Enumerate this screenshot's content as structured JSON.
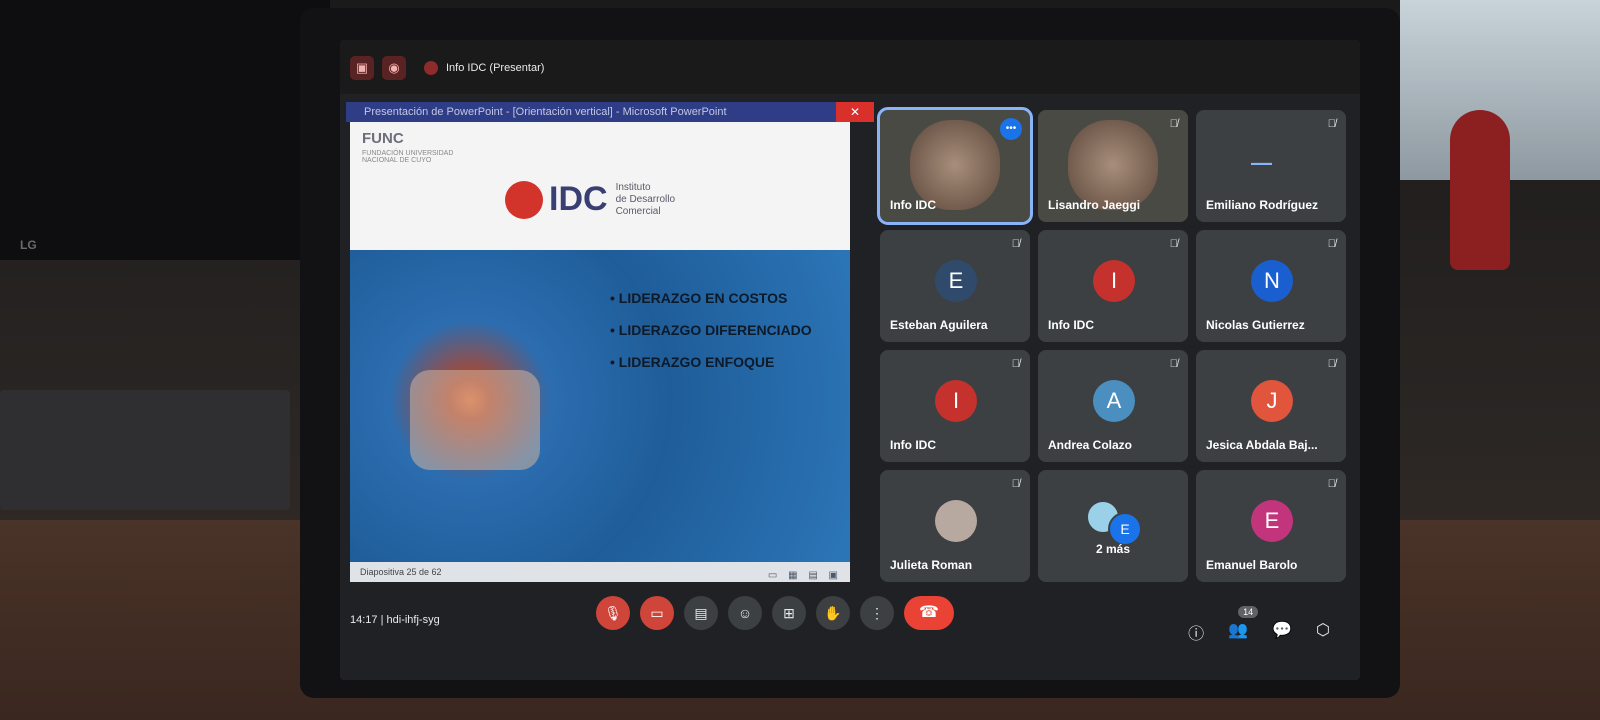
{
  "meet": {
    "presenting_label": "Info IDC (Presentar)",
    "time": "14:17",
    "meeting_code": "hdi-ihfj-syg",
    "participant_count": "14"
  },
  "powerpoint": {
    "window_title": "Presentación de PowerPoint - [Orientación vertical] - Microsoft PowerPoint",
    "status": "Diapositiva 25 de 62",
    "close_glyph": "✕",
    "view_icons": "▭ ▦ ▤ ▣"
  },
  "slide": {
    "func_logo": "FUNC",
    "func_sub": "FUNDACIÓN UNIVERSIDAD NACIONAL DE CUYO",
    "idc": "IDC",
    "idc_sub_1": "Instituto",
    "idc_sub_2": "de Desarrollo",
    "idc_sub_3": "Comercial",
    "bullets": [
      "LIDERAZGO EN COSTOS",
      "LIDERAZGO DIFERENCIADO",
      "LIDERAZGO ENFOQUE"
    ]
  },
  "participants": [
    {
      "name": "Info IDC",
      "type": "camera",
      "active": true
    },
    {
      "name": "Lisandro Jaeggi",
      "type": "camera"
    },
    {
      "name": "Emiliano Rodríguez",
      "type": "logo"
    },
    {
      "name": "Esteban Aguilera",
      "initial": "E",
      "color": "#2f4a6b"
    },
    {
      "name": "Info IDC",
      "initial": "I",
      "color": "#c5312c"
    },
    {
      "name": "Nicolas Gutierrez",
      "initial": "N",
      "color": "#1a5fd0"
    },
    {
      "name": "Info IDC",
      "initial": "I",
      "color": "#c5312c"
    },
    {
      "name": "Andrea Colazo",
      "initial": "A",
      "color": "#4a8fc0"
    },
    {
      "name": "Jesica Abdala Baj...",
      "initial": "J",
      "color": "#e0553c"
    },
    {
      "name": "Julieta Roman",
      "type": "photo"
    },
    {
      "name": "2 más",
      "type": "more"
    },
    {
      "name": "Emanuel Barolo",
      "initial": "E",
      "color": "#c2347c"
    }
  ]
}
